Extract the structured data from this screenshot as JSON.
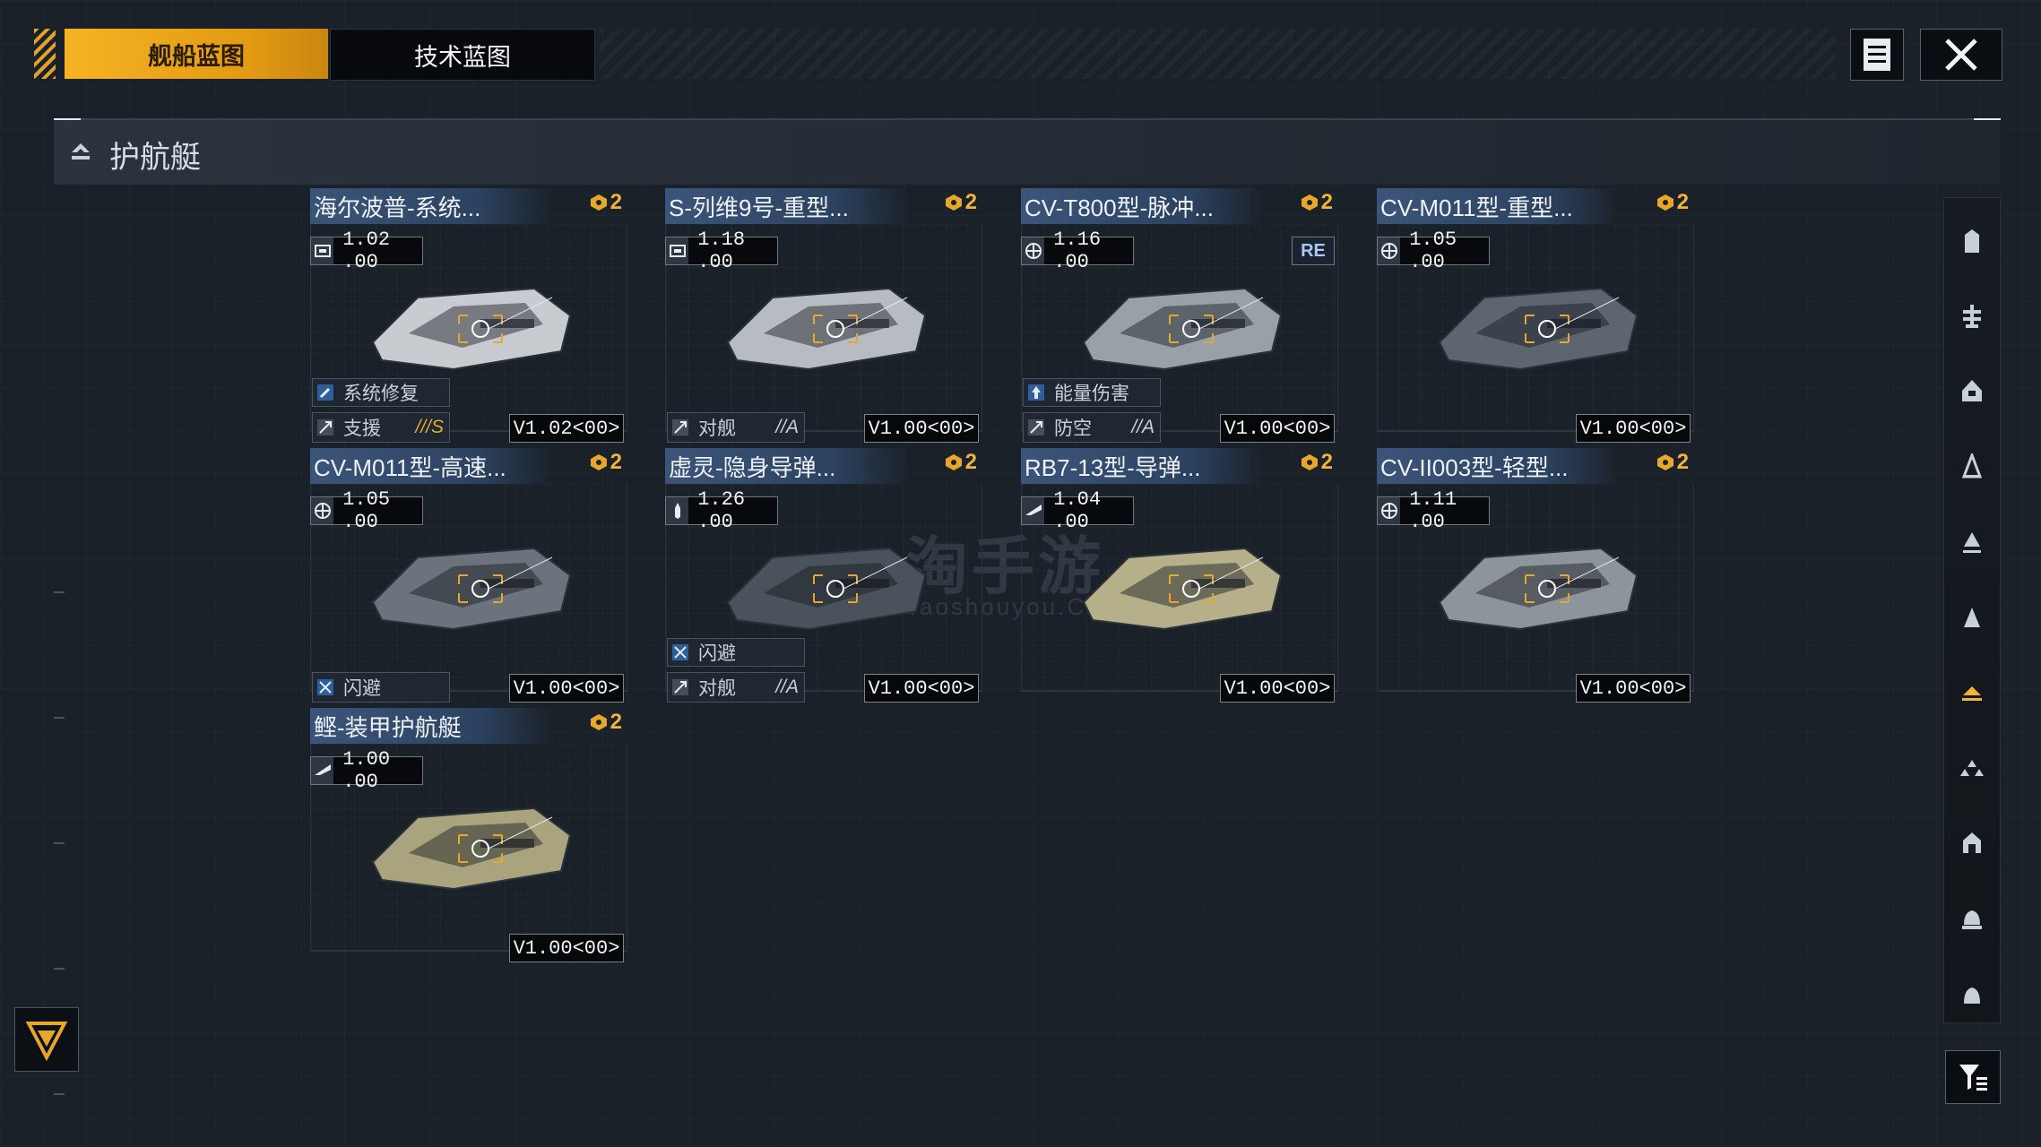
{
  "tabs": [
    {
      "label": "舰船蓝图",
      "active": true
    },
    {
      "label": "技术蓝图",
      "active": false
    }
  ],
  "toolbar": {
    "list_icon": "document-list-icon",
    "close_icon": "close-icon"
  },
  "section": {
    "title": "护航艇",
    "icon": "escort-class-icon"
  },
  "cards": [
    {
      "title": "海尔波普-系统...",
      "count": "2",
      "stat": "1.02 .00",
      "stat_icon": "module-icon",
      "skill": "系统修复",
      "skill_icon": "repair-icon",
      "role": "支援",
      "grade": "///S",
      "grade_gold": true,
      "version": "V1.02<00>"
    },
    {
      "title": "S-列维9号-重型...",
      "count": "2",
      "stat": "1.18 .00",
      "stat_icon": "module-icon",
      "skill": "",
      "role": "对舰",
      "grade": "//A",
      "grade_gold": false,
      "version": "V1.00<00>"
    },
    {
      "title": "CV-T800型-脉冲...",
      "count": "2",
      "stat": "1.16 .00",
      "stat_icon": "globe-icon",
      "re": "RE",
      "skill": "能量伤害",
      "skill_icon": "energy-icon",
      "role": "防空",
      "grade": "//A",
      "grade_gold": false,
      "version": "V1.00<00>"
    },
    {
      "title": "CV-M011型-重型...",
      "count": "2",
      "stat": "1.05 .00",
      "stat_icon": "globe-icon",
      "skill": "",
      "role": "",
      "grade": "",
      "version": "V1.00<00>"
    },
    {
      "title": "CV-M011型-高速...",
      "count": "2",
      "stat": "1.05 .00",
      "stat_icon": "globe-icon",
      "skill": "",
      "role": "闪避",
      "grade": "",
      "version": "V1.00<00>"
    },
    {
      "title": "虚灵-隐身导弹...",
      "count": "2",
      "stat": "1.26 .00",
      "stat_icon": "missile-icon",
      "skill": "闪避",
      "skill_icon": "evade-icon",
      "role": "对舰",
      "grade": "//A",
      "grade_gold": false,
      "version": "V1.00<00>"
    },
    {
      "title": "RB7-13型-导弹...",
      "count": "2",
      "stat": "1.04 .00",
      "stat_icon": "wing-icon",
      "skill": "",
      "role": "",
      "grade": "",
      "version": "V1.00<00>"
    },
    {
      "title": "CV-II003型-轻型...",
      "count": "2",
      "stat": "1.11 .00",
      "stat_icon": "globe-icon",
      "skill": "",
      "role": "",
      "grade": "",
      "version": "V1.00<00>"
    },
    {
      "title": "鲣-装甲护航艇",
      "count": "2",
      "stat": "1.00 .00",
      "stat_icon": "wing-icon",
      "skill": "",
      "role": "",
      "grade": "",
      "version": "V1.00<00>"
    }
  ],
  "watermark": {
    "main": "淘手游",
    "sub": "Taoshouyou.Com"
  },
  "colors": {
    "accent": "#f5b324",
    "title_bar": "#3b557a",
    "bg": "#1b2129"
  }
}
